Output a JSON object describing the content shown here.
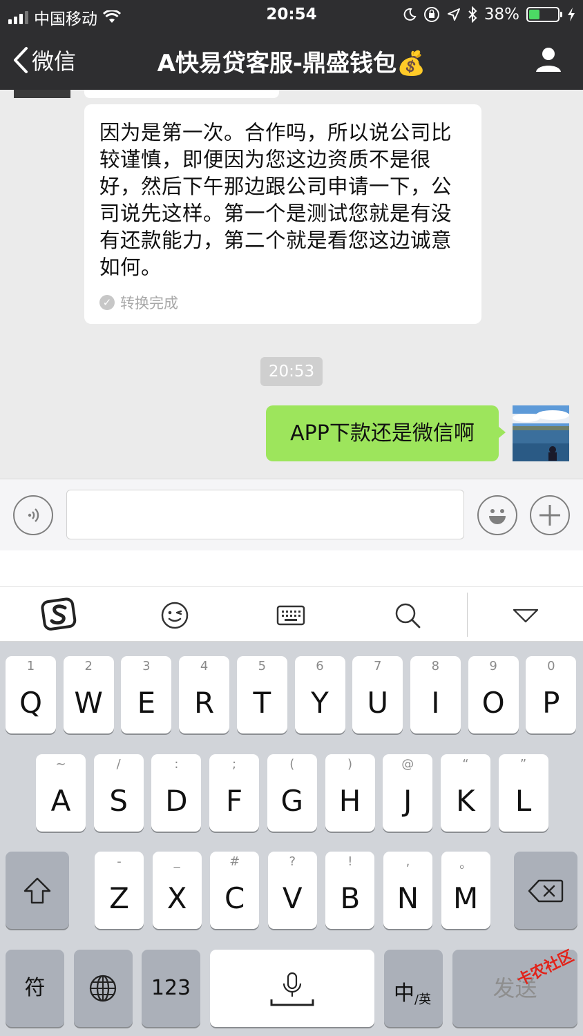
{
  "status_bar": {
    "carrier": "中国移动",
    "time": "20:54",
    "battery_percent": "38%",
    "battery_level": 0.38,
    "icons": [
      "wifi-icon",
      "moon-icon",
      "rotation-lock-icon",
      "location-icon",
      "bluetooth-icon",
      "charging-icon"
    ]
  },
  "nav": {
    "back_label": "微信",
    "title": "A快易贷客服-鼎盛钱包💰",
    "profile_icon": "person-icon"
  },
  "messages": [
    {
      "direction": "incoming",
      "text": "因为是第一次。合作吗，所以说公司比较谨慎，即便因为您这边资质不是很好，然后下午那边跟公司申请一下，公司说先这样。第一个是测试您就是有没有还款能力，第二个就是看您这边诚意如何。",
      "status": "转换完成"
    },
    {
      "direction": "timestamp",
      "text": "20:53"
    },
    {
      "direction": "outgoing",
      "text": "APP下款还是微信啊"
    }
  ],
  "input_bar": {
    "voice_icon": "voice-icon",
    "emoji_icon": "emoji-icon",
    "plus_icon": "plus-icon",
    "value": ""
  },
  "keyboard_toolbar": {
    "icons": [
      "sogou-logo-icon",
      "wink-emoji-icon",
      "keyboard-icon",
      "search-icon",
      "collapse-icon"
    ]
  },
  "keyboard": {
    "row1": [
      {
        "key": "Q",
        "hint": "1"
      },
      {
        "key": "W",
        "hint": "2"
      },
      {
        "key": "E",
        "hint": "3"
      },
      {
        "key": "R",
        "hint": "4"
      },
      {
        "key": "T",
        "hint": "5"
      },
      {
        "key": "Y",
        "hint": "6"
      },
      {
        "key": "U",
        "hint": "7"
      },
      {
        "key": "I",
        "hint": "8"
      },
      {
        "key": "O",
        "hint": "9"
      },
      {
        "key": "P",
        "hint": "0"
      }
    ],
    "row2": [
      {
        "key": "A",
        "hint": "~"
      },
      {
        "key": "S",
        "hint": "/"
      },
      {
        "key": "D",
        "hint": ":"
      },
      {
        "key": "F",
        "hint": ";"
      },
      {
        "key": "G",
        "hint": "("
      },
      {
        "key": "H",
        "hint": ")"
      },
      {
        "key": "J",
        "hint": "@"
      },
      {
        "key": "K",
        "hint": "“"
      },
      {
        "key": "L",
        "hint": "”"
      }
    ],
    "row3": [
      {
        "key": "Z",
        "hint": "-"
      },
      {
        "key": "X",
        "hint": "_"
      },
      {
        "key": "C",
        "hint": "#"
      },
      {
        "key": "V",
        "hint": "?"
      },
      {
        "key": "B",
        "hint": "!"
      },
      {
        "key": "N",
        "hint": ","
      },
      {
        "key": "M",
        "hint": "。"
      }
    ],
    "symbols_label": "符",
    "numbers_label": "123",
    "lang_main": "中",
    "lang_sub": "/英",
    "send_label": "发送",
    "shift_icon": "shift-icon",
    "backspace_icon": "backspace-icon",
    "globe_icon": "globe-icon",
    "mic_icon": "mic-icon"
  },
  "watermark": "卡农社区"
}
